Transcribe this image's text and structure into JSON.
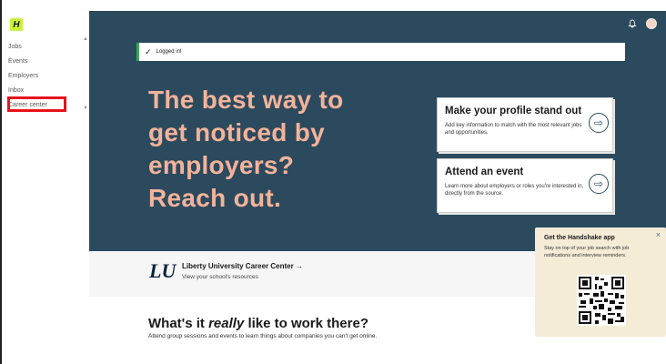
{
  "sidebar": {
    "logo_text": "H",
    "items": [
      {
        "label": "Jobs"
      },
      {
        "label": "Events"
      },
      {
        "label": "Employers"
      },
      {
        "label": "Inbox"
      },
      {
        "label": "Career center"
      }
    ]
  },
  "banner": {
    "message": "Logged in!"
  },
  "hero": {
    "headline_lines": [
      "The best way to",
      "get noticed by",
      "employers?",
      "Reach out."
    ],
    "cards": [
      {
        "title": "Make your profile stand out",
        "desc": "Add key information to match with the most relevant jobs and opportunities."
      },
      {
        "title": "Attend an event",
        "desc": "Learn more about employers or roles you're interested in, directly from the source."
      }
    ]
  },
  "school": {
    "logo_text": "LU",
    "title": "Liberty University Career Center →",
    "subtitle": "View your school's resources"
  },
  "section": {
    "title_pre": "What's it ",
    "title_em": "really",
    "title_post": " like to work there?",
    "subtitle": "Attend group sessions and events to learn things about companies you can't get online."
  },
  "promo": {
    "title": "Get the Handshake app",
    "desc": "Stay on top of your job search with job notifications and interview reminders.",
    "close": "×"
  },
  "colors": {
    "hero_bg": "#2c4a5e",
    "headline": "#f3b39a",
    "highlight_box": "#e8131b",
    "logo_bg": "#c8f23c",
    "promo_bg": "#f5ecd7"
  }
}
